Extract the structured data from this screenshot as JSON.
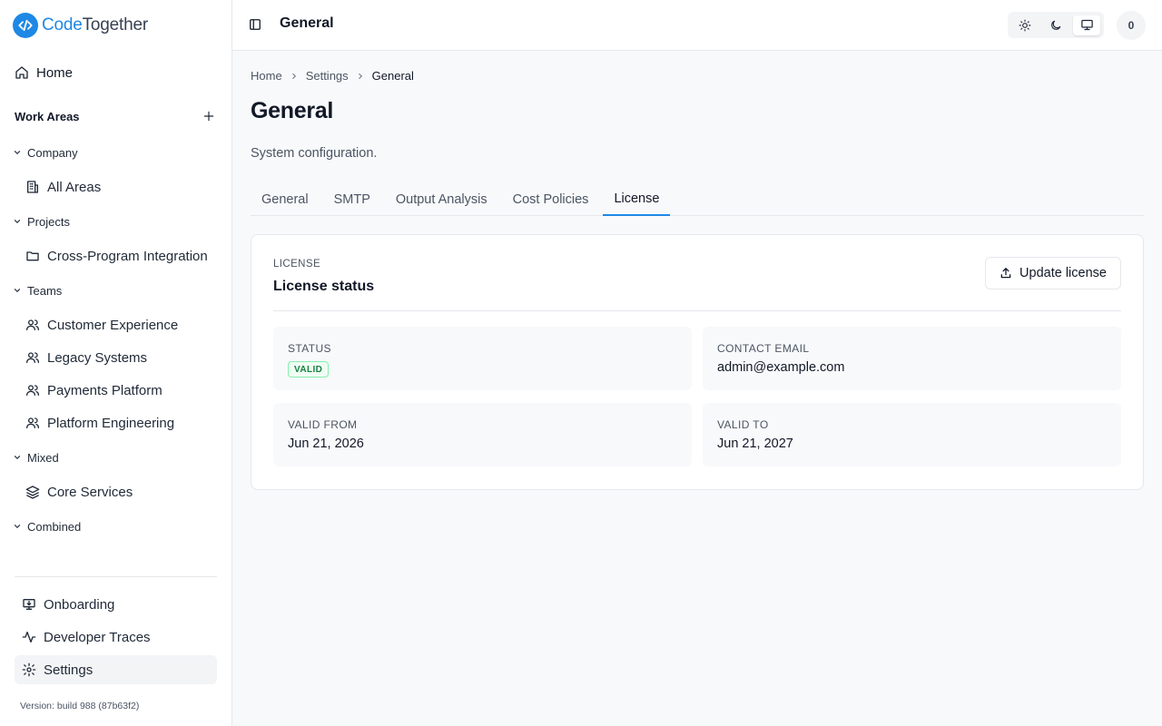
{
  "brand": {
    "part1": "Code",
    "part2": "Together"
  },
  "sidebar": {
    "home_label": "Home",
    "work_areas_title": "Work Areas",
    "groups": [
      {
        "label": "Company",
        "items": [
          {
            "label": "All Areas"
          }
        ]
      },
      {
        "label": "Projects",
        "items": [
          {
            "label": "Cross-Program Integration"
          }
        ]
      },
      {
        "label": "Teams",
        "items": [
          {
            "label": "Customer Experience"
          },
          {
            "label": "Legacy Systems"
          },
          {
            "label": "Payments Platform"
          },
          {
            "label": "Platform Engineering"
          }
        ]
      },
      {
        "label": "Mixed",
        "items": [
          {
            "label": "Core Services"
          }
        ]
      },
      {
        "label": "Combined",
        "items": []
      }
    ],
    "bottom_nav": [
      {
        "label": "Onboarding"
      },
      {
        "label": "Developer Traces"
      },
      {
        "label": "Settings"
      }
    ],
    "version": "Version: build 988 (87b63f2)"
  },
  "header": {
    "title": "General",
    "avatar_text": "0"
  },
  "breadcrumb": {
    "items": [
      "Home",
      "Settings",
      "General"
    ]
  },
  "page": {
    "title": "General",
    "description": "System configuration."
  },
  "tabs": [
    {
      "label": "General"
    },
    {
      "label": "SMTP"
    },
    {
      "label": "Output Analysis"
    },
    {
      "label": "Cost Policies"
    },
    {
      "label": "License"
    }
  ],
  "license": {
    "kicker": "LICENSE",
    "title": "License status",
    "update_button": "Update license",
    "fields": {
      "status_label": "STATUS",
      "status_value": "VALID",
      "email_label": "CONTACT EMAIL",
      "email_value": "admin@example.com",
      "valid_from_label": "VALID FROM",
      "valid_from_value": "Jun 21, 2026",
      "valid_to_label": "VALID TO",
      "valid_to_value": "Jun 21, 2027"
    }
  },
  "colors": {
    "accent": "#1e88e5",
    "status_valid": "#15803d"
  }
}
